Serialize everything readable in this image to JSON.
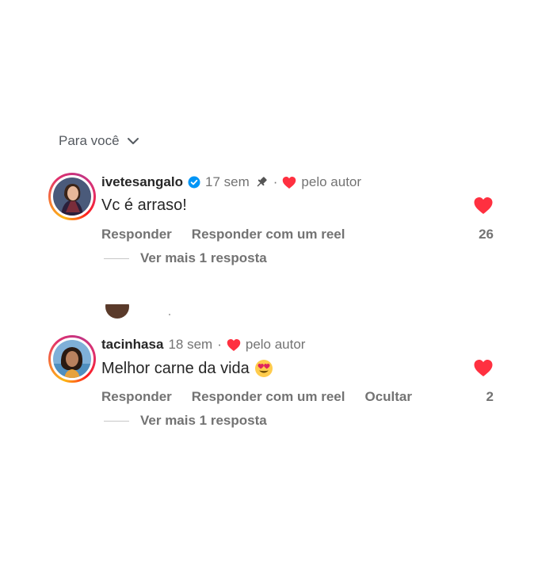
{
  "sort": {
    "label": "Para você",
    "icon": "chevron-down-icon"
  },
  "comments": [
    {
      "username": "ivetesangalo",
      "verified": true,
      "time": "17 sem",
      "pinned": true,
      "separator": "·",
      "liked_by_author": "pelo autor",
      "text": "Vc é arraso!",
      "like_count": "26",
      "actions": [
        "Responder",
        "Responder com um reel"
      ],
      "more_replies": "Ver mais 1 resposta"
    },
    {
      "username": "tacinhasa",
      "verified": false,
      "time": "18 sem",
      "pinned": false,
      "separator": "·",
      "liked_by_author": "pelo autor",
      "text": "Melhor carne da vida",
      "emoji": "heart-eyes-emoji",
      "like_count": "2",
      "actions": [
        "Responder",
        "Responder com um reel",
        "Ocultar"
      ],
      "more_replies": "Ver mais 1 resposta"
    }
  ],
  "colors": {
    "like_red": "#ff3040",
    "verified_blue": "#0095f6",
    "muted_text": "#737373"
  }
}
